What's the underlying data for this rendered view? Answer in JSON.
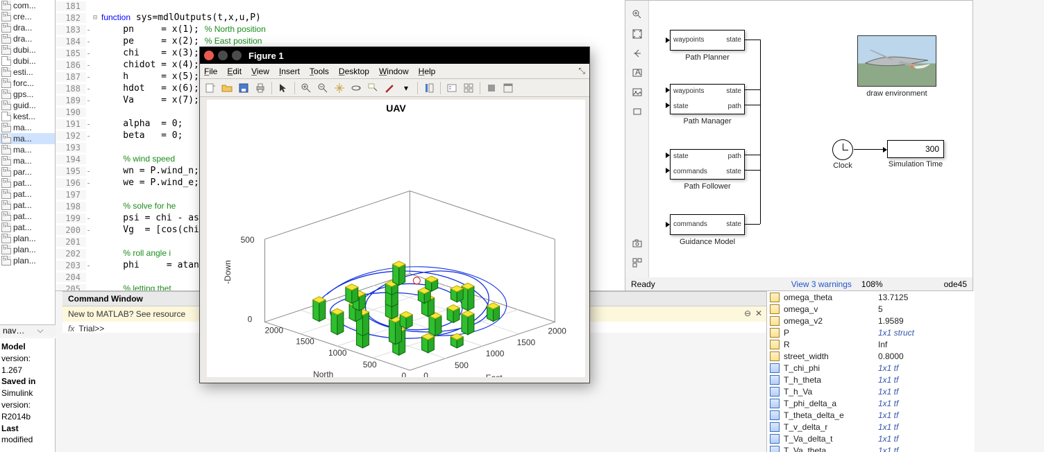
{
  "files": [
    {
      "name": "com...",
      "t": "fx"
    },
    {
      "name": "cre...",
      "t": "fx"
    },
    {
      "name": "dra...",
      "t": "fx"
    },
    {
      "name": "dra...",
      "t": "fx"
    },
    {
      "name": "dubi...",
      "t": "fx"
    },
    {
      "name": "dubi...",
      "t": "doc"
    },
    {
      "name": "esti...",
      "t": "fx"
    },
    {
      "name": "forc...",
      "t": "fx"
    },
    {
      "name": "gps...",
      "t": "fx"
    },
    {
      "name": "guid...",
      "t": "fx"
    },
    {
      "name": "kest...",
      "t": "doc"
    },
    {
      "name": "ma...",
      "t": "fx"
    },
    {
      "name": "ma...",
      "t": "fx",
      "sel": true
    },
    {
      "name": "ma...",
      "t": "fx"
    },
    {
      "name": "ma...",
      "t": "fx"
    },
    {
      "name": "par...",
      "t": "fx"
    },
    {
      "name": "pat...",
      "t": "fx"
    },
    {
      "name": "pat...",
      "t": "fx"
    },
    {
      "name": "pat...",
      "t": "fx"
    },
    {
      "name": "pat...",
      "t": "fx"
    },
    {
      "name": "pat...",
      "t": "fx"
    },
    {
      "name": "plan...",
      "t": "fx"
    },
    {
      "name": "plan...",
      "t": "fx"
    },
    {
      "name": "plan...",
      "t": "fx"
    }
  ],
  "file_dd": "navsi...",
  "info_lines": [
    "Model",
    "version:",
    "1.267",
    "Saved in",
    "Simulink",
    "version:",
    "R2014b",
    "Last",
    "modified"
  ],
  "info_bold": [
    0,
    3,
    7
  ],
  "code": [
    {
      "ln": 181,
      "dash": "",
      "fold": "",
      "src": ""
    },
    {
      "ln": 182,
      "dash": "",
      "fold": "⊟",
      "src": "<kw>function</kw> sys=mdlOutputs(t,x,u,P)"
    },
    {
      "ln": 183,
      "dash": "-",
      "fold": "",
      "src": "    pn     = x(1); <cm>% North position</cm>"
    },
    {
      "ln": 184,
      "dash": "-",
      "fold": "",
      "src": "    pe     = x(2); <cm>% East position</cm>"
    },
    {
      "ln": 185,
      "dash": "-",
      "fold": "",
      "src": "    chi    = x(3);"
    },
    {
      "ln": 186,
      "dash": "-",
      "fold": "",
      "src": "    chidot = x(4);"
    },
    {
      "ln": 187,
      "dash": "-",
      "fold": "",
      "src": "    h      = x(5);"
    },
    {
      "ln": 188,
      "dash": "-",
      "fold": "",
      "src": "    hdot   = x(6);"
    },
    {
      "ln": 189,
      "dash": "-",
      "fold": "",
      "src": "    Va     = x(7);"
    },
    {
      "ln": 190,
      "dash": "",
      "fold": "",
      "src": ""
    },
    {
      "ln": 191,
      "dash": "-",
      "fold": "",
      "src": "    alpha  = 0;"
    },
    {
      "ln": 192,
      "dash": "-",
      "fold": "",
      "src": "    beta   = 0;"
    },
    {
      "ln": 193,
      "dash": "",
      "fold": "",
      "src": ""
    },
    {
      "ln": 194,
      "dash": "",
      "fold": "",
      "src": "    <cm>% wind speed</cm>"
    },
    {
      "ln": 195,
      "dash": "-",
      "fold": "",
      "src": "    wn = P.wind_n;"
    },
    {
      "ln": 196,
      "dash": "-",
      "fold": "",
      "src": "    we = P.wind_e;"
    },
    {
      "ln": 197,
      "dash": "",
      "fold": "",
      "src": ""
    },
    {
      "ln": 198,
      "dash": "",
      "fold": "",
      "src": "    <cm>% solve for he</cm>"
    },
    {
      "ln": 199,
      "dash": "-",
      "fold": "",
      "src": "    psi = chi - as"
    },
    {
      "ln": 200,
      "dash": "-",
      "fold": "",
      "src": "    Vg  = [cos(chi"
    },
    {
      "ln": 201,
      "dash": "",
      "fold": "",
      "src": ""
    },
    {
      "ln": 202,
      "dash": "",
      "fold": "",
      "src": "    <cm>% roll angle i</cm>"
    },
    {
      "ln": 203,
      "dash": "-",
      "fold": "",
      "src": "    phi     = atan"
    },
    {
      "ln": 204,
      "dash": "",
      "fold": "",
      "src": ""
    },
    {
      "ln": 205,
      "dash": "",
      "fold": "",
      "src": "    <cm>% letting thet</cm>"
    }
  ],
  "cmd_title": "Command Window",
  "cmd_hint": "New to MATLAB? See resource",
  "cmd_prompt": "Trial>>",
  "figure": {
    "title": "Figure 1",
    "menus": [
      "File",
      "Edit",
      "View",
      "Insert",
      "Tools",
      "Desktop",
      "Window",
      "Help"
    ],
    "plot_title": "UAV",
    "axes": {
      "z_label": "-Down",
      "x_label": "North",
      "y_label": "East",
      "z_ticks": [
        "500",
        "0"
      ],
      "x_ticks": [
        "2000",
        "1500",
        "1000",
        "500",
        "0"
      ],
      "y_ticks": [
        "0",
        "500",
        "1000",
        "1500",
        "2000"
      ]
    }
  },
  "simulink": {
    "blocks": [
      {
        "name": "Path Planner",
        "ports_l": [
          "waypoints"
        ],
        "ports_r": [
          "state"
        ]
      },
      {
        "name": "Path Manager",
        "ports_l": [
          "waypoints",
          "state"
        ],
        "ports_r": [
          "state",
          "path"
        ]
      },
      {
        "name": "Path Follower",
        "ports_l": [
          "state",
          "commands"
        ],
        "ports_r": [
          "path",
          "state"
        ]
      },
      {
        "name": "Guidance Model",
        "ports_l": [
          "commands"
        ],
        "ports_r": [
          "state"
        ]
      }
    ],
    "draw_env": "draw environment",
    "clock": "Clock",
    "sim_time_label": "Simulation Time",
    "sim_time_value": "300",
    "status": {
      "ready": "Ready",
      "warn": "View 3 warnings",
      "zoom": "108%",
      "solver": "ode45"
    }
  },
  "workspace": [
    {
      "n": "omega_theta",
      "v": "13.7125",
      "ico": "y"
    },
    {
      "n": "omega_v",
      "v": "5",
      "ico": "y"
    },
    {
      "n": "omega_v2",
      "v": "1.9589",
      "ico": "y"
    },
    {
      "n": "P",
      "v": "1x1 struct",
      "ico": "y",
      "it": true
    },
    {
      "n": "R",
      "v": "Inf",
      "ico": "y"
    },
    {
      "n": "street_width",
      "v": "0.8000",
      "ico": "y"
    },
    {
      "n": "T_chi_phi",
      "v": "1x1 tf",
      "ico": "b",
      "it": true
    },
    {
      "n": "T_h_theta",
      "v": "1x1 tf",
      "ico": "b",
      "it": true
    },
    {
      "n": "T_h_Va",
      "v": "1x1 tf",
      "ico": "b",
      "it": true
    },
    {
      "n": "T_phi_delta_a",
      "v": "1x1 tf",
      "ico": "b",
      "it": true
    },
    {
      "n": "T_theta_delta_e",
      "v": "1x1 tf",
      "ico": "b",
      "it": true
    },
    {
      "n": "T_v_delta_r",
      "v": "1x1 tf",
      "ico": "b",
      "it": true
    },
    {
      "n": "T_Va_delta_t",
      "v": "1x1 tf",
      "ico": "b",
      "it": true
    },
    {
      "n": "T_Va_theta",
      "v": "1x1 tf",
      "ico": "b",
      "it": true
    }
  ],
  "chart_data": {
    "type": "scatter",
    "title": "UAV",
    "xlabel": "North",
    "ylabel": "East",
    "zlabel": "-Down",
    "xlim": [
      0,
      2000
    ],
    "ylim": [
      0,
      2000
    ],
    "zlim": [
      0,
      500
    ],
    "note": "3-D plot: blue trajectory path among ~25 green building cuboids with yellow tops; positions estimated from image.",
    "buildings_xy": [
      [
        200,
        850
      ],
      [
        300,
        550
      ],
      [
        400,
        1200
      ],
      [
        450,
        300
      ],
      [
        500,
        1650
      ],
      [
        600,
        950
      ],
      [
        700,
        500
      ],
      [
        750,
        1350
      ],
      [
        850,
        200
      ],
      [
        900,
        1700
      ],
      [
        950,
        900
      ],
      [
        1050,
        1300
      ],
      [
        1100,
        450
      ],
      [
        1150,
        1800
      ],
      [
        1250,
        1000
      ],
      [
        1300,
        300
      ],
      [
        1350,
        1550
      ],
      [
        1450,
        700
      ],
      [
        1500,
        1250
      ],
      [
        1550,
        1850
      ],
      [
        1650,
        950
      ],
      [
        1700,
        450
      ],
      [
        1750,
        1500
      ],
      [
        1850,
        1050
      ],
      [
        1900,
        1750
      ]
    ],
    "building_height_range": [
      80,
      260
    ],
    "trajectory_hint": "looping blue spline across full grid, crossing itself multiple times around center (≈1000,1000)"
  }
}
